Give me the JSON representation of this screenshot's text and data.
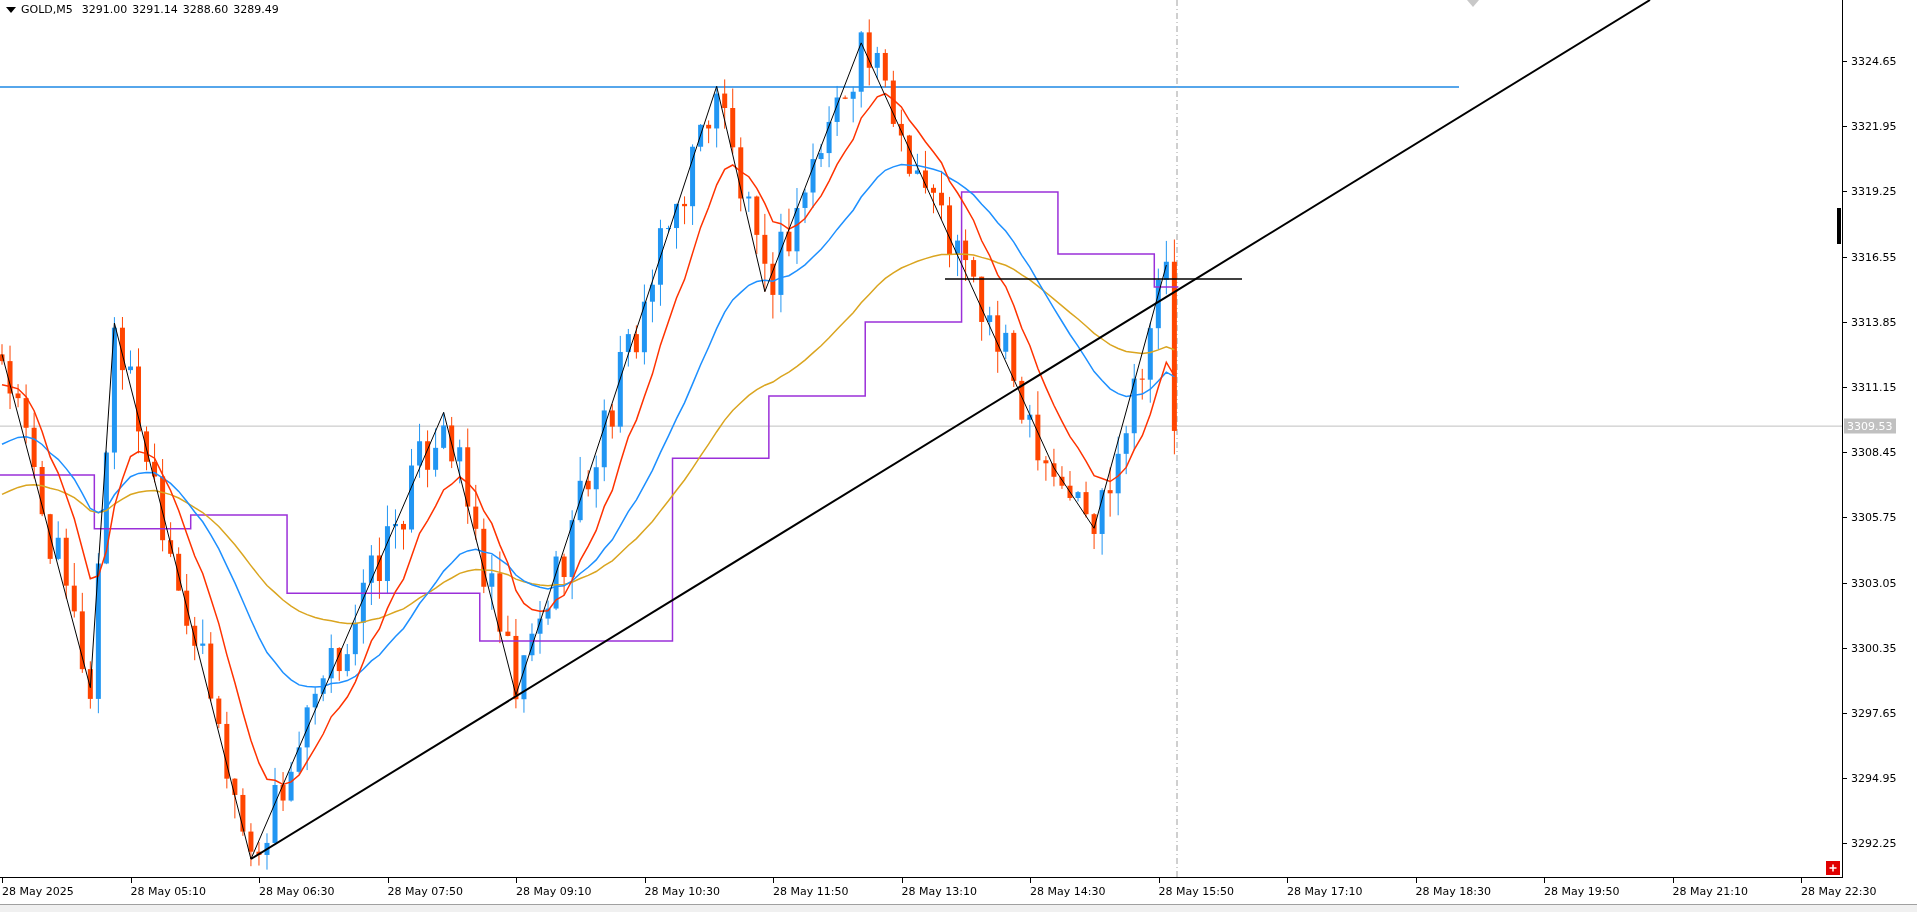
{
  "header": {
    "symbol": "GOLD,M5",
    "ohlc": [
      "3291.00",
      "3291.14",
      "3288.60",
      "3289.49"
    ]
  },
  "price_axis": {
    "labels": [
      "3324.65",
      "3321.95",
      "3319.25",
      "3316.55",
      "3313.85",
      "3311.15",
      "3308.45",
      "3305.75",
      "3303.05",
      "3300.35",
      "3297.65",
      "3294.95",
      "3292.25"
    ],
    "current_price": "3309.53"
  },
  "time_axis": {
    "labels": [
      "28 May 2025",
      "28 May 05:10",
      "28 May 06:30",
      "28 May 07:50",
      "28 May 09:10",
      "28 May 10:30",
      "28 May 11:50",
      "28 May 13:10",
      "28 May 14:30",
      "28 May 15:50",
      "28 May 17:10",
      "28 May 18:30",
      "28 May 19:50",
      "28 May 21:10",
      "28 May 22:30"
    ]
  }
}
